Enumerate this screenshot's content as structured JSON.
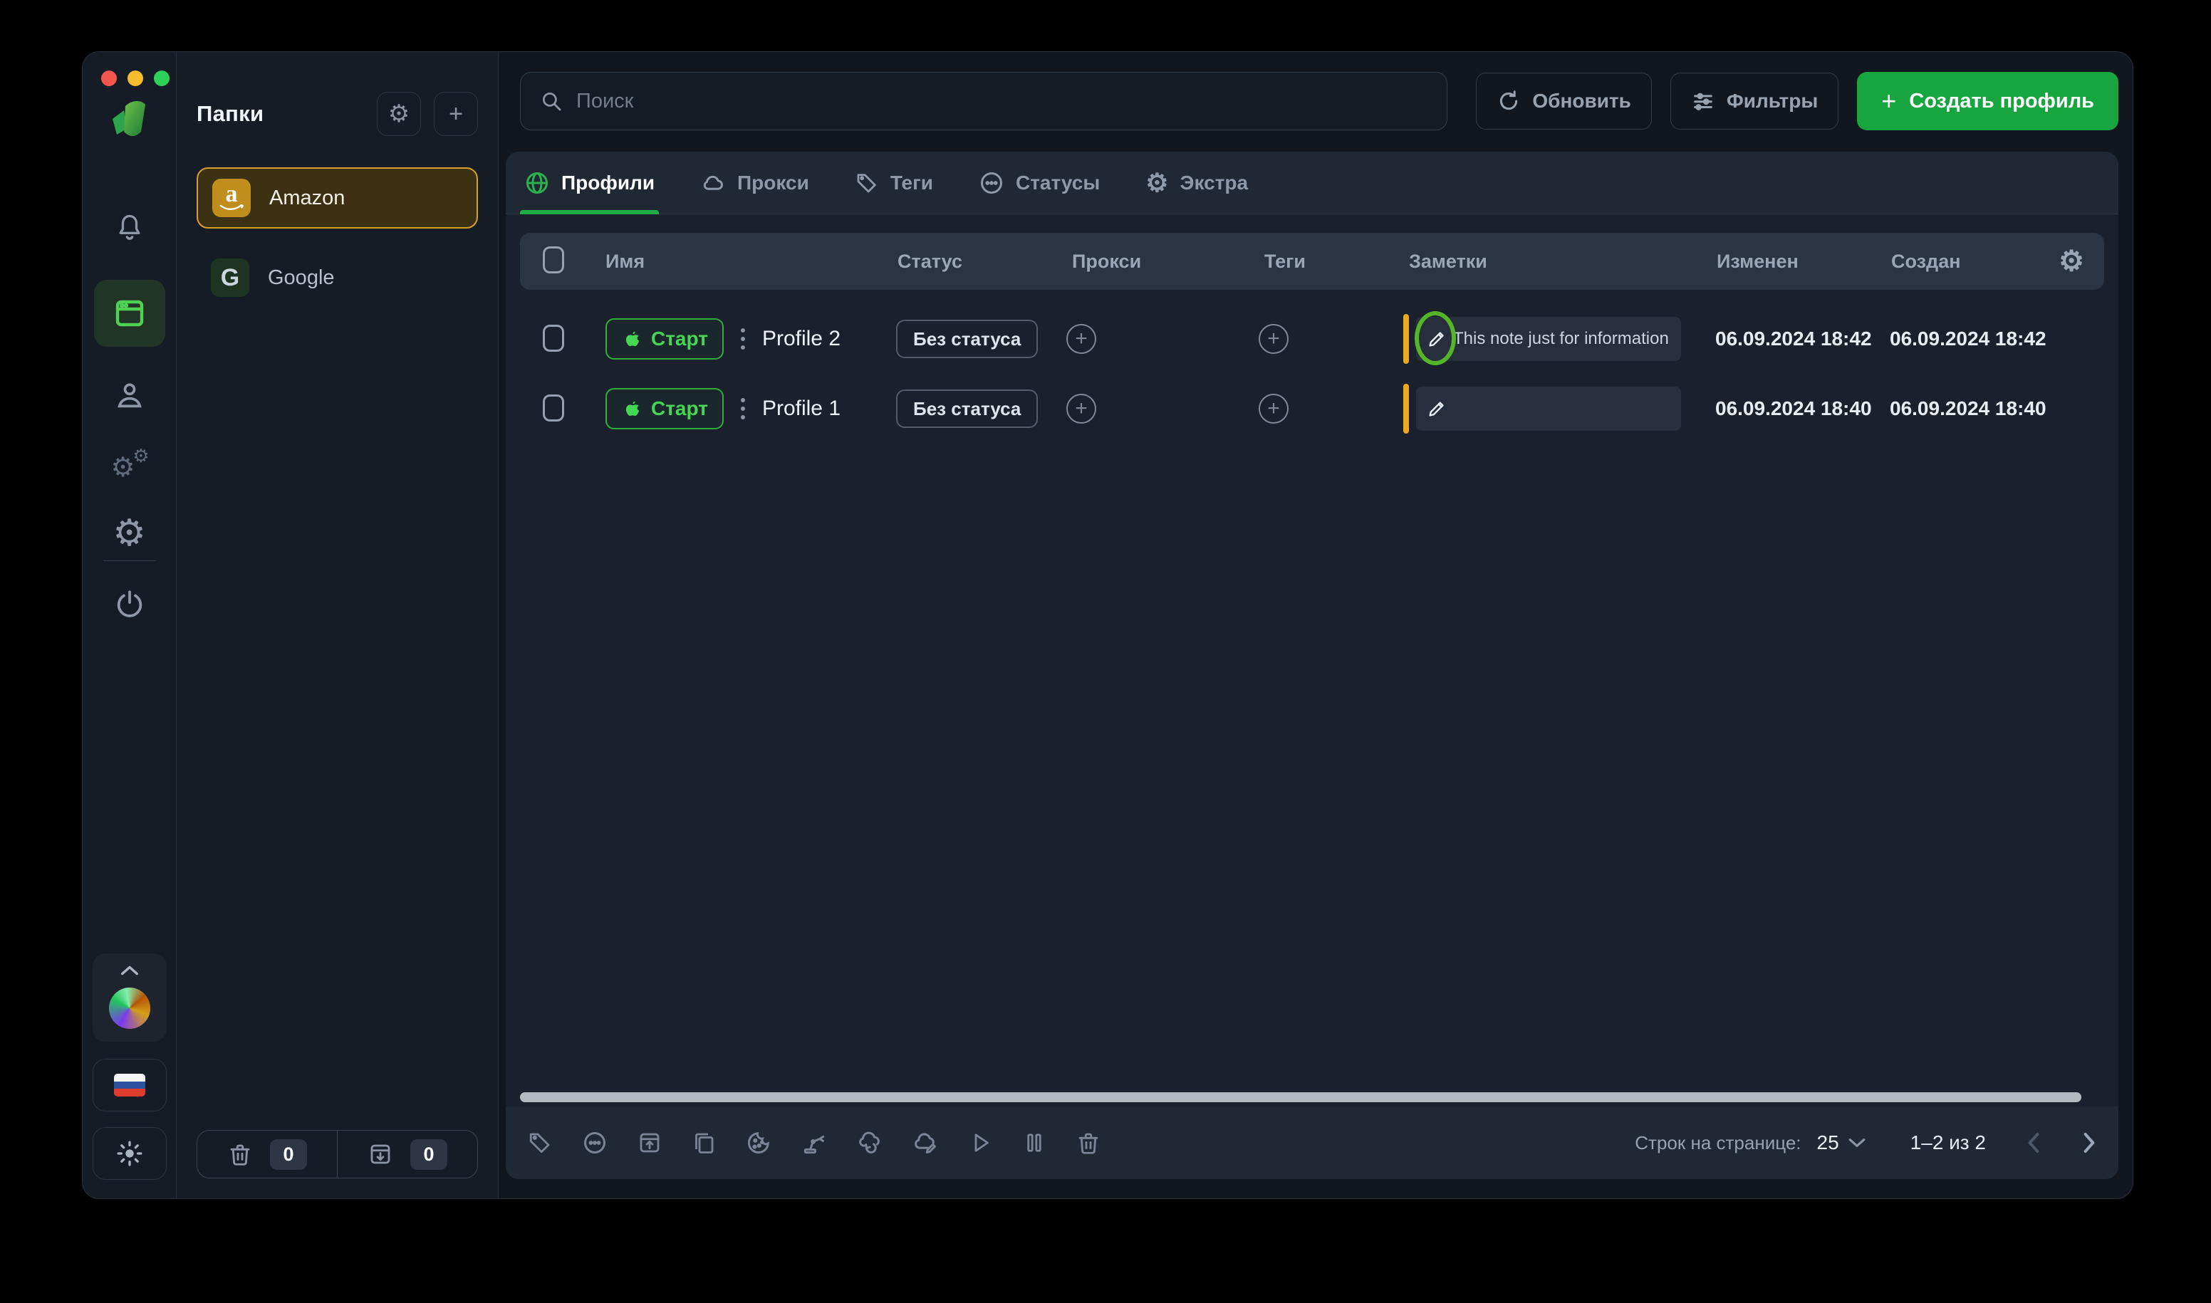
{
  "window": {
    "traffic_lights": {
      "close": "#f2564d",
      "minimize": "#f6bd2f",
      "zoom": "#2ed158"
    }
  },
  "folders": {
    "title": "Папки",
    "items": [
      {
        "label": "Amazon",
        "selected": true
      },
      {
        "label": "Google",
        "selected": false
      }
    ],
    "trash_count": "0",
    "archive_count": "0"
  },
  "topbar": {
    "search_placeholder": "Поиск",
    "refresh_label": "Обновить",
    "filters_label": "Фильтры",
    "create_profile_label": "Создать профиль"
  },
  "tabs": [
    {
      "label": "Профили",
      "active": true
    },
    {
      "label": "Прокси",
      "active": false
    },
    {
      "label": "Теги",
      "active": false
    },
    {
      "label": "Статусы",
      "active": false
    },
    {
      "label": "Экстра",
      "active": false
    }
  ],
  "table": {
    "columns": [
      "Имя",
      "Статус",
      "Прокси",
      "Теги",
      "Заметки",
      "Изменен",
      "Создан"
    ],
    "start_label": "Старт",
    "rows": [
      {
        "name": "Profile 2",
        "status": "Без статуса",
        "note": "This note just for information",
        "note_highlighted": true,
        "modified": "06.09.2024 18:42",
        "created": "06.09.2024 18:42"
      },
      {
        "name": "Profile 1",
        "status": "Без статуса",
        "note": "",
        "note_highlighted": false,
        "modified": "06.09.2024 18:40",
        "created": "06.09.2024 18:40"
      }
    ]
  },
  "footer": {
    "rows_per_page_label": "Строк на странице:",
    "rows_per_page": "25",
    "range": "1–2 из 2"
  },
  "icons_glyphs": {
    "gear-icon": "⚙",
    "plus-icon": "+"
  },
  "colors": {
    "accent_green": "#16a53f",
    "start_green": "#45d654",
    "tab_green": "#2bb04c",
    "folder_gold": "#d6a02a",
    "note_bar_yellow": "#eda81e",
    "highlight_ring_green": "#55b528"
  }
}
